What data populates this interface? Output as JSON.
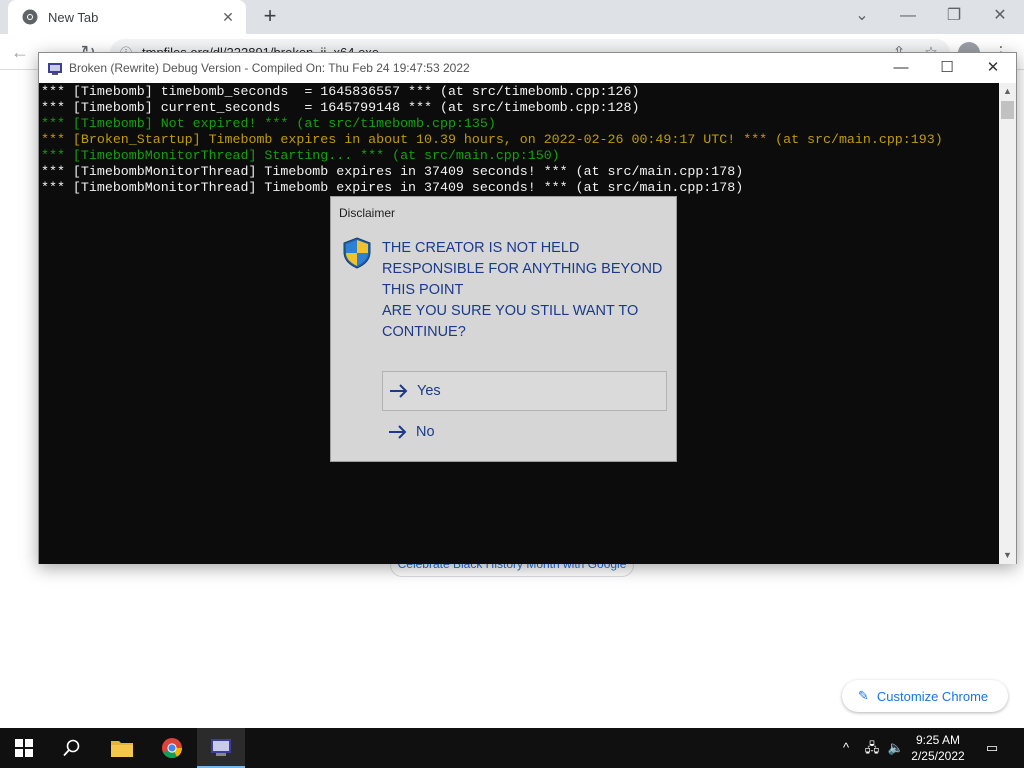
{
  "browser": {
    "tab_title": "New Tab",
    "tab_close_glyph": "✕",
    "new_tab_glyph": "+",
    "address": "tmpfiles.org/dl/222891/broken_ii_x64.exe",
    "doodle_text": "Celebrate Black History Month with Google",
    "customize_label": "Customize Chrome",
    "window_controls": {
      "dropdown": "⌄",
      "minimize": "—",
      "restore": "❐",
      "close": "✕"
    }
  },
  "console": {
    "title": "Broken (Rewrite) Debug Version - Compiled On: Thu Feb 24 19:47:53 2022",
    "controls": {
      "minimize": "—",
      "maximize": "☐",
      "close": "✕"
    },
    "lines": [
      {
        "text": "*** [Timebomb] timebomb_seconds  = 1645836557 *** (at src/timebomb.cpp:126)",
        "color": "white"
      },
      {
        "text": "*** [Timebomb] current_seconds   = 1645799148 *** (at src/timebomb.cpp:128)",
        "color": "white"
      },
      {
        "text": "*** [Timebomb] Not expired! *** (at src/timebomb.cpp:135)",
        "color": "green"
      },
      {
        "text": "*** [Broken_Startup] Timebomb expires in about 10.39 hours, on 2022-02-26 00:49:17 UTC! *** (at src/main.cpp:193)",
        "color": "orange"
      },
      {
        "text": "*** [TimebombMonitorThread] Starting... *** (at src/main.cpp:150)",
        "color": "green"
      },
      {
        "text": "*** [TimebombMonitorThread] Timebomb expires in 37409 seconds! *** (at src/main.cpp:178)",
        "color": "white"
      },
      {
        "text": "*** [TimebombMonitorThread] Timebomb expires in 37409 seconds! *** (at src/main.cpp:178)",
        "color": "white"
      }
    ],
    "colors": {
      "white": "#f2f2f2",
      "green": "#13a10e",
      "orange": "#c19c00"
    }
  },
  "dialog": {
    "title": "Disclaimer",
    "message_lines": [
      "THE CREATOR IS NOT HELD",
      "RESPONSIBLE FOR ANYTHING BEYOND",
      "THIS POINT",
      "ARE YOU SURE YOU STILL WANT TO",
      "CONTINUE?"
    ],
    "yes_label": "Yes",
    "no_label": "No",
    "text_color": "#1b3a8a"
  },
  "taskbar": {
    "time": "9:25 AM",
    "date": "2/25/2022",
    "tray_icons": [
      "chevron-up-icon",
      "network-icon",
      "volume-icon",
      "notifications-icon"
    ]
  }
}
